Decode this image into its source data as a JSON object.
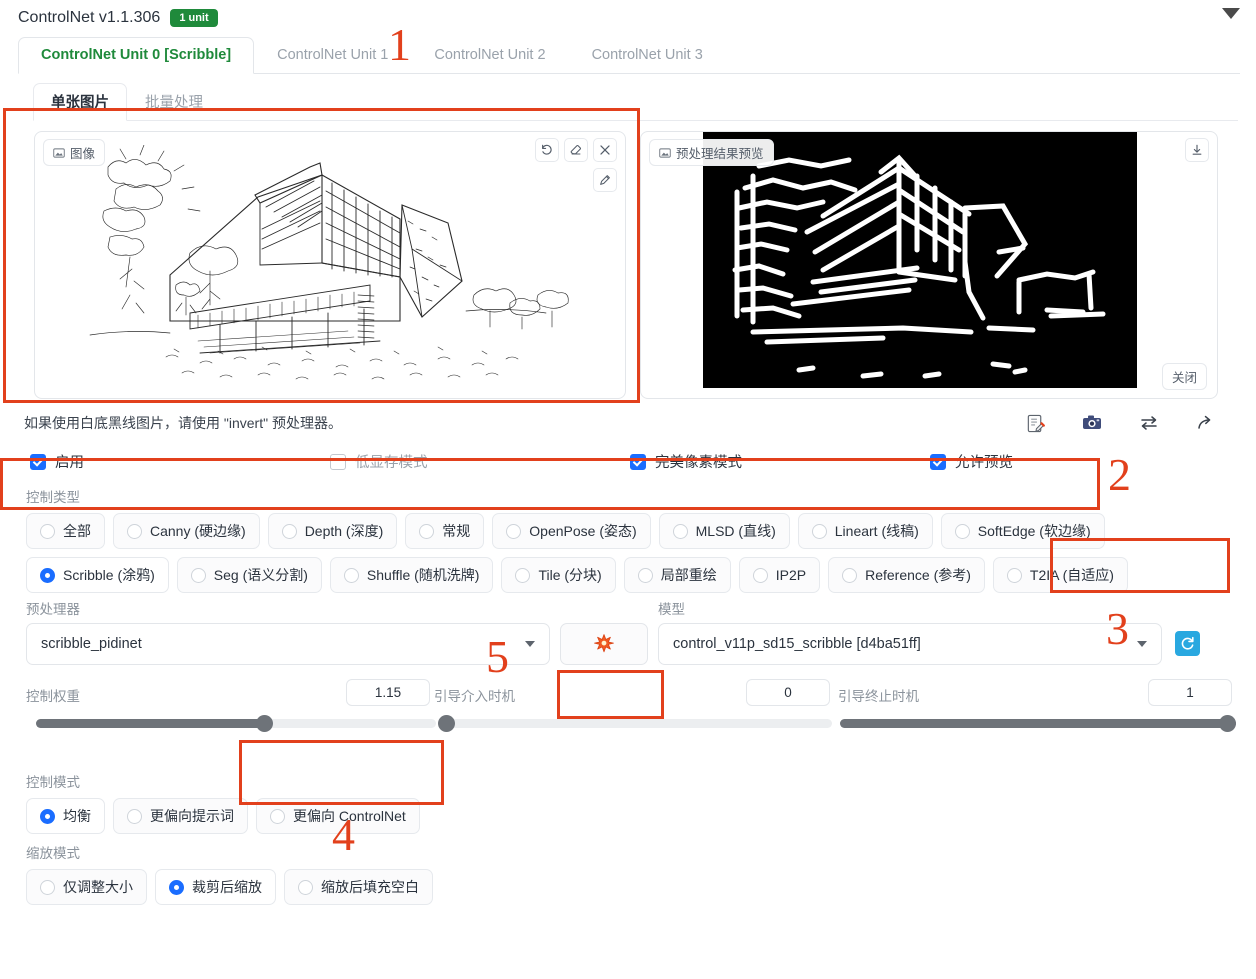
{
  "header": {
    "title": "ControlNet v1.1.306",
    "badge": "1 unit",
    "collapse_icon": "chevron-down-icon"
  },
  "unit_tabs": [
    {
      "label": "ControlNet Unit 0 [Scribble]",
      "active": true
    },
    {
      "label": "ControlNet Unit 1",
      "active": false
    },
    {
      "label": "ControlNet Unit 2",
      "active": false
    },
    {
      "label": "ControlNet Unit 3",
      "active": false
    }
  ],
  "sub_tabs": [
    {
      "label": "单张图片",
      "active": true
    },
    {
      "label": "批量处理",
      "active": false
    }
  ],
  "image_panel": {
    "left_tag": "图像",
    "left_tag_icon": "image-icon",
    "tools": [
      {
        "name": "undo-icon",
        "glyph": "↺"
      },
      {
        "name": "eraser-icon",
        "glyph": "◇"
      },
      {
        "name": "close-icon",
        "glyph": "✕"
      }
    ],
    "pen_tool": {
      "name": "pen-icon",
      "glyph": "✎"
    },
    "right_tag": "预处理结果预览",
    "right_tag_icon": "image-icon",
    "download_icon": "download-icon",
    "close_label": "关闭"
  },
  "hint": {
    "text": "如果使用白底黑线图片，请使用 \"invert\" 预处理器。",
    "icons": [
      {
        "name": "edit-note-icon"
      },
      {
        "name": "camera-icon"
      },
      {
        "name": "swap-icon"
      },
      {
        "name": "share-arrow-icon"
      }
    ]
  },
  "checkboxes": [
    {
      "label": "启用",
      "checked": true
    },
    {
      "label": "低显存模式",
      "checked": false
    },
    {
      "label": "完美像素模式",
      "checked": true
    },
    {
      "label": "允许预览",
      "checked": true
    }
  ],
  "control_type": {
    "label": "控制类型",
    "options": [
      {
        "label": "全部",
        "selected": false
      },
      {
        "label": "Canny (硬边缘)",
        "selected": false
      },
      {
        "label": "Depth (深度)",
        "selected": false
      },
      {
        "label": "常规",
        "selected": false
      },
      {
        "label": "OpenPose (姿态)",
        "selected": false
      },
      {
        "label": "MLSD (直线)",
        "selected": false
      },
      {
        "label": "Lineart (线稿)",
        "selected": false
      },
      {
        "label": "SoftEdge (软边缘)",
        "selected": false
      },
      {
        "label": "Scribble (涂鸦)",
        "selected": true
      },
      {
        "label": "Seg (语义分割)",
        "selected": false
      },
      {
        "label": "Shuffle (随机洗牌)",
        "selected": false
      },
      {
        "label": "Tile (分块)",
        "selected": false
      },
      {
        "label": "局部重绘",
        "selected": false
      },
      {
        "label": "IP2P",
        "selected": false
      },
      {
        "label": "Reference (参考)",
        "selected": false
      },
      {
        "label": "T2IA (自适应)",
        "selected": false
      }
    ]
  },
  "preprocessor": {
    "label": "预处理器",
    "value": "scribble_pidinet",
    "run_icon": "spark-icon"
  },
  "model": {
    "label": "模型",
    "value": "control_v11p_sd15_scribble [d4ba51ff]",
    "refresh_icon": "refresh-icon"
  },
  "sliders": [
    {
      "label": "控制权重",
      "value": "1.15",
      "percent": 57
    },
    {
      "label": "引导介入时机",
      "value": "0",
      "percent": 0
    },
    {
      "label": "引导终止时机",
      "value": "1",
      "percent": 100
    }
  ],
  "control_mode": {
    "label": "控制模式",
    "options": [
      {
        "label": "均衡",
        "selected": true
      },
      {
        "label": "更偏向提示词",
        "selected": false
      },
      {
        "label": "更偏向 ControlNet",
        "selected": false
      }
    ]
  },
  "resize_mode": {
    "label": "缩放模式",
    "options": [
      {
        "label": "仅调整大小",
        "selected": false
      },
      {
        "label": "裁剪后缩放",
        "selected": true
      },
      {
        "label": "缩放后填充空白",
        "selected": false
      }
    ]
  },
  "annotations": {
    "color": "#e2401c",
    "markers": [
      "1",
      "2",
      "3",
      "4",
      "5"
    ]
  }
}
